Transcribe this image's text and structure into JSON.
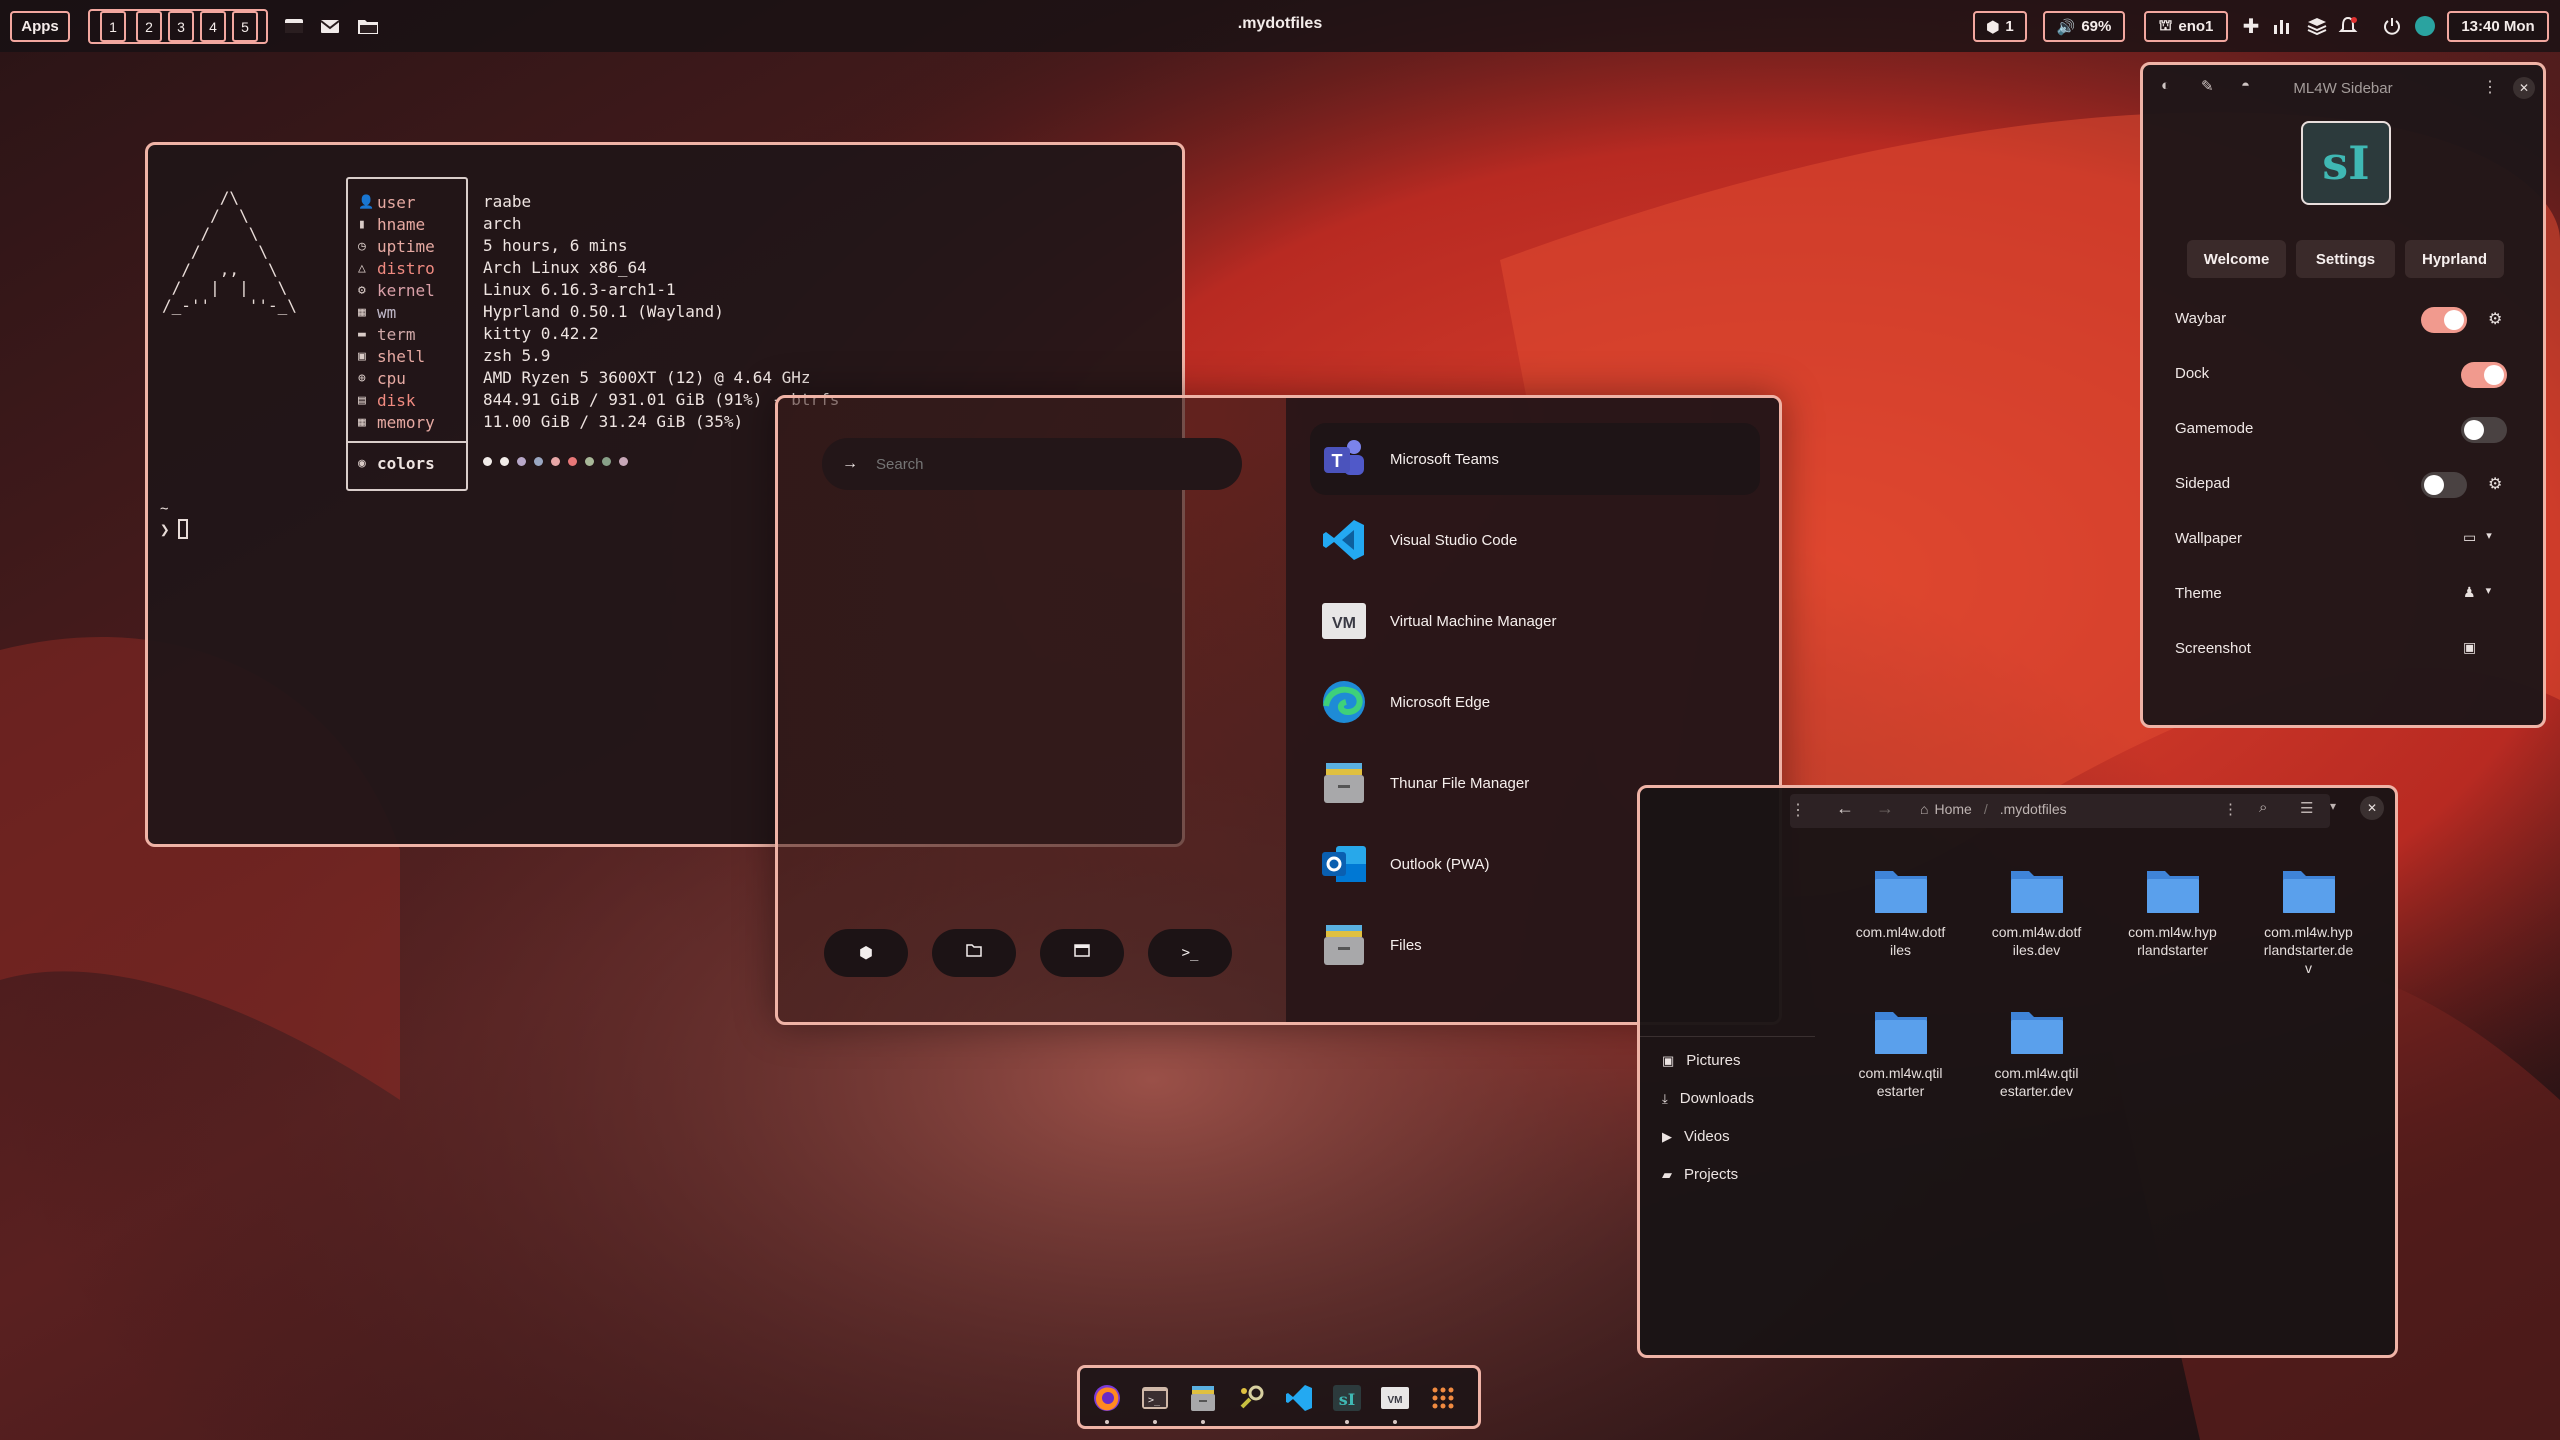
{
  "topbar": {
    "apps_label": "Apps",
    "workspaces": [
      "1",
      "2",
      "3",
      "4",
      "5"
    ],
    "window_title": ".mydotfiles",
    "updates_count": "1",
    "volume": "69%",
    "network": "eno1",
    "clock": "13:40 Mon"
  },
  "terminal": {
    "ascii_logo": "      /\\\n     /  \\\n    /    \\\n   /      \\\n  /   ,,   \\\n /   |  |   \\\n/_-''    ''-_\\",
    "fetch": [
      {
        "key": "user",
        "value": "raabe",
        "icon": "user-icon"
      },
      {
        "key": "hname",
        "value": "arch",
        "icon": "host-icon"
      },
      {
        "key": "uptime",
        "value": "5 hours, 6 mins",
        "icon": "clock-icon"
      },
      {
        "key": "distro",
        "value": "Arch Linux x86_64",
        "icon": "arch-icon"
      },
      {
        "key": "kernel",
        "value": "Linux 6.16.3-arch1-1",
        "icon": "gear-icon"
      },
      {
        "key": "wm",
        "value": "Hyprland 0.50.1 (Wayland)",
        "icon": "wm-icon"
      },
      {
        "key": "term",
        "value": "kitty 0.42.2",
        "icon": "terminal-icon"
      },
      {
        "key": "shell",
        "value": "zsh 5.9",
        "icon": "shell-icon"
      },
      {
        "key": "cpu",
        "value": "AMD Ryzen 5 3600XT (12) @ 4.64 GHz",
        "icon": "cpu-icon"
      },
      {
        "key": "disk",
        "value": "844.91 GiB / 931.01 GiB (91%) - btrfs",
        "icon": "disk-icon"
      },
      {
        "key": "memory",
        "value": "11.00 GiB / 31.24 GiB (35%)",
        "icon": "memory-icon"
      }
    ],
    "colors_label": "colors",
    "color_dots": [
      "#f2ece9",
      "#f2ece9",
      "#b8a8c9",
      "#9aa7c2",
      "#e8a8a8",
      "#e87878",
      "#a8b898",
      "#88a088",
      "#c8a8b8"
    ],
    "prompt_tilde": "~",
    "prompt_symbol": "❯"
  },
  "launcher": {
    "search_placeholder": "Search",
    "apps": [
      {
        "name": "Microsoft Teams",
        "icon": "teams-icon"
      },
      {
        "name": "Visual Studio Code",
        "icon": "vscode-icon"
      },
      {
        "name": "Virtual Machine Manager",
        "icon": "vmm-icon"
      },
      {
        "name": "Microsoft Edge",
        "icon": "edge-icon"
      },
      {
        "name": "Thunar File Manager",
        "icon": "thunar-icon"
      },
      {
        "name": "Outlook (PWA)",
        "icon": "outlook-icon"
      },
      {
        "name": "Files",
        "icon": "files-icon"
      }
    ],
    "mode_buttons": [
      "apps-mode-icon",
      "files-mode-icon",
      "windows-mode-icon",
      "terminal-mode-icon"
    ]
  },
  "sidebar": {
    "title": "ML4W Sidebar",
    "logo_text": "sI",
    "tabs": [
      "Welcome",
      "Settings",
      "Hyprland"
    ],
    "rows": [
      {
        "label": "Waybar",
        "toggle": true,
        "on": true,
        "gear": true
      },
      {
        "label": "Dock",
        "toggle": true,
        "on": true,
        "gear": false
      },
      {
        "label": "Gamemode",
        "toggle": true,
        "on": false,
        "gear": false
      },
      {
        "label": "Sidepad",
        "toggle": true,
        "on": false,
        "gear": true
      },
      {
        "label": "Wallpaper",
        "toggle": false
      },
      {
        "label": "Theme",
        "toggle": false
      },
      {
        "label": "Screenshot",
        "toggle": false
      }
    ]
  },
  "files": {
    "breadcrumb_home": "Home",
    "breadcrumb_current": ".mydotfiles",
    "sidebar_items": [
      "Pictures",
      "Downloads",
      "Videos",
      "Projects"
    ],
    "folders": [
      "com.ml4w.dotf\niles",
      "com.ml4w.dotf\niles.dev",
      "com.ml4w.hyp\nrlandstarter",
      "com.ml4w.hyp\nrlandstarter.de\nv",
      "com.ml4w.qtil\nestarter",
      "com.ml4w.qtil\nestarter.dev"
    ]
  },
  "dock": {
    "apps": [
      "firefox-icon",
      "terminal-icon",
      "files-icon",
      "settings-icon",
      "vscode-icon",
      "ml4w-icon",
      "vmm-icon",
      "app-grid-icon"
    ]
  },
  "colors": {
    "accent": "#efb3a6",
    "toggle_on": "#f19a8e",
    "toggle_off": "#4a4242"
  }
}
